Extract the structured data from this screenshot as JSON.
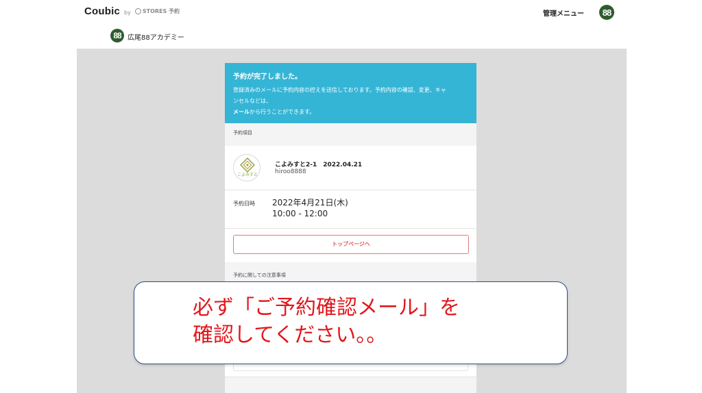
{
  "header": {
    "logo": "Coubic",
    "logo_by": "by",
    "logo_stores": "STORES 予約",
    "admin_menu": "管理メニュー",
    "avatar_text": "88"
  },
  "shop": {
    "avatar_text": "88",
    "name": "広尾88アカデミー"
  },
  "confirmation": {
    "title": "予約が完了しました。",
    "message_line1": "登録済みのメールに予約内容の控えを送信しております。予約内容の確認、変更、キャ",
    "message_line2": "ンセルなどは、",
    "message_line3_bold": "メール",
    "message_line3_rest": "から行うことができます。"
  },
  "reservation": {
    "section_label": "予約項目",
    "item_title": "こよみすと2-1　2022.04.21",
    "item_sub": "hiroo8888",
    "thumb_caption": "こよみすと",
    "date_label": "予約日時",
    "date": "2022年4月21日(木)",
    "time": "10:00 - 12:00",
    "top_button": "トップページへ",
    "notes_label": "予約に関しての注意事項"
  },
  "callout": {
    "text": "必ず「ご予約確認メール」を\n確認してください。。"
  },
  "colors": {
    "banner": "#35b5d6",
    "button_border": "#e2787a",
    "callout_text": "#e2171c",
    "callout_border": "#2d4f87"
  }
}
